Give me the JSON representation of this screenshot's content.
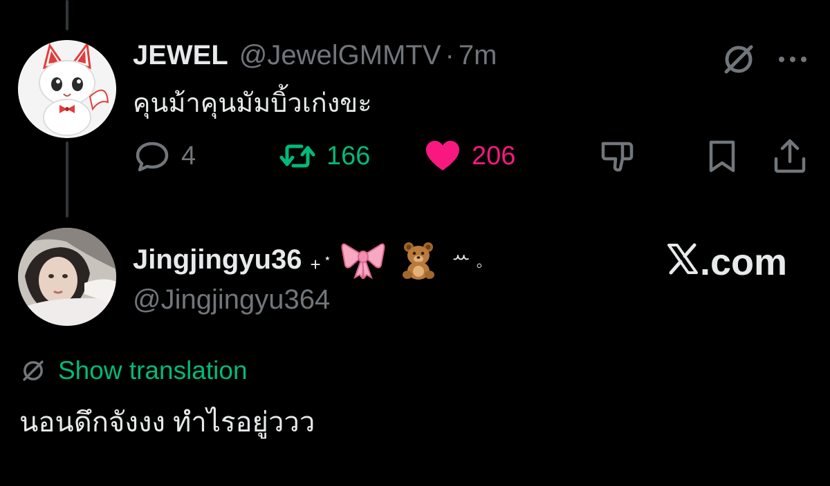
{
  "colors": {
    "background": "#000000",
    "text_primary": "#e7e9ea",
    "text_secondary": "#71767b",
    "retweet_green": "#00ba7c",
    "like_pink": "#f91880",
    "thread_line": "#333639"
  },
  "tweet": {
    "display_name": "JEWEL",
    "handle": "@JewelGMMTV",
    "separator": "·",
    "time": "7m",
    "text": "คุนม้าคุนมัมบิ้วเก่งขะ",
    "avatar_icon": "white-cat-plush-avatar",
    "top_icons": [
      "translate-off-icon",
      "more-icon"
    ],
    "actions": {
      "reply": {
        "icon": "reply-icon",
        "count": "4"
      },
      "retweet": {
        "icon": "retweet-icon",
        "count": "166"
      },
      "like": {
        "icon": "heart-filled-icon",
        "count": "206"
      },
      "dislike": {
        "icon": "thumbs-down-icon"
      },
      "bookmark": {
        "icon": "bookmark-icon"
      },
      "share": {
        "icon": "share-icon"
      }
    }
  },
  "reply": {
    "display_name": "Jingjingyu36",
    "decorations": [
      "+",
      "⋆",
      "🎀",
      "🧸",
      "ꕀ",
      "◦"
    ],
    "handle": "@Jingjingyu364",
    "avatar_icon": "profile-photo-avatar",
    "translation_label": "Show translation",
    "text": "นอนดึกจังงง ทำไรอยู่ววว"
  },
  "watermark": {
    "text": ".com",
    "logo": "x-logo"
  }
}
